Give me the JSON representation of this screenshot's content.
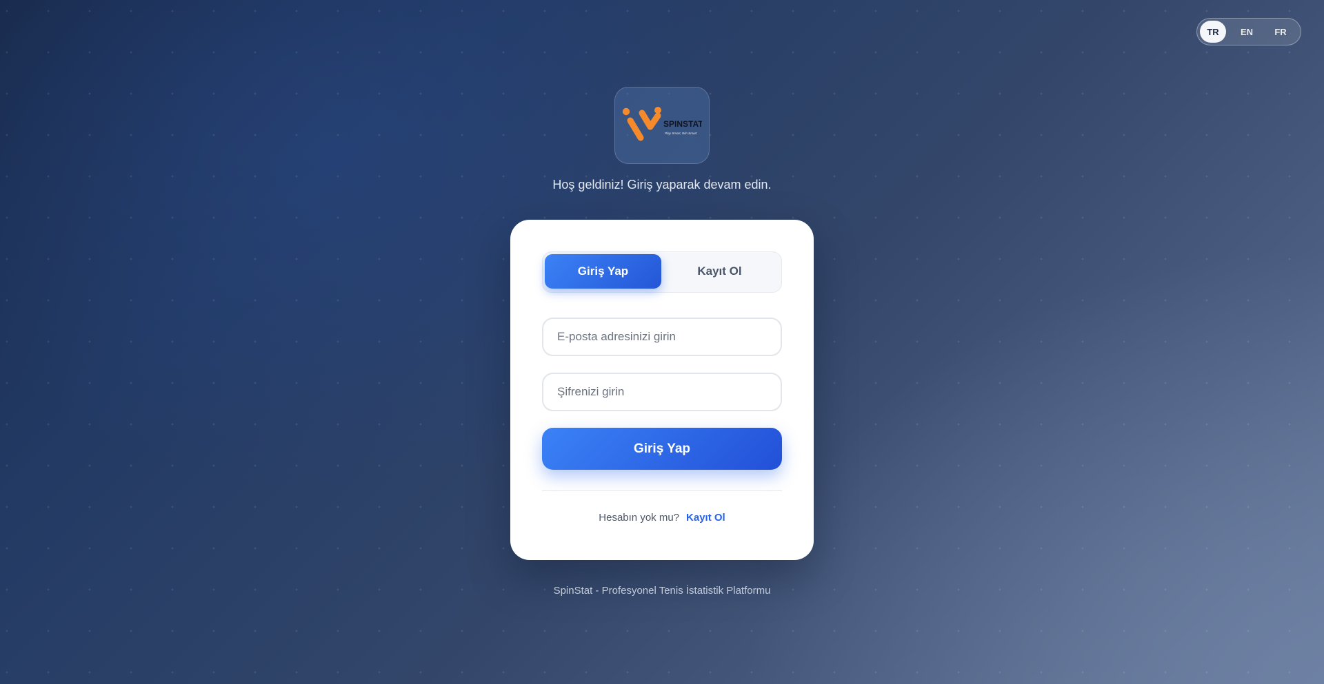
{
  "language": {
    "options": [
      "TR",
      "EN",
      "FR"
    ],
    "active": "TR"
  },
  "logo": {
    "text": "SPINSTAT",
    "tagline": "Play Smart, Win Smart",
    "color": "#f58a2c"
  },
  "header": {
    "welcome": "Hoş geldiniz! Giriş yaparak devam edin."
  },
  "tabs": {
    "login": "Giriş Yap",
    "register": "Kayıt Ol",
    "active": "login"
  },
  "form": {
    "email_placeholder": "E-posta adresinizi girin",
    "password_placeholder": "Şifrenizi girin",
    "submit_label": "Giriş Yap"
  },
  "signup": {
    "prompt": "Hesabın yok mu?",
    "link": "Kayıt Ol"
  },
  "footer": {
    "text": "SpinStat - Profesyonel Tenis İstatistik Platformu"
  },
  "colors": {
    "primary": "#2563eb",
    "accent": "#f58a2c"
  }
}
